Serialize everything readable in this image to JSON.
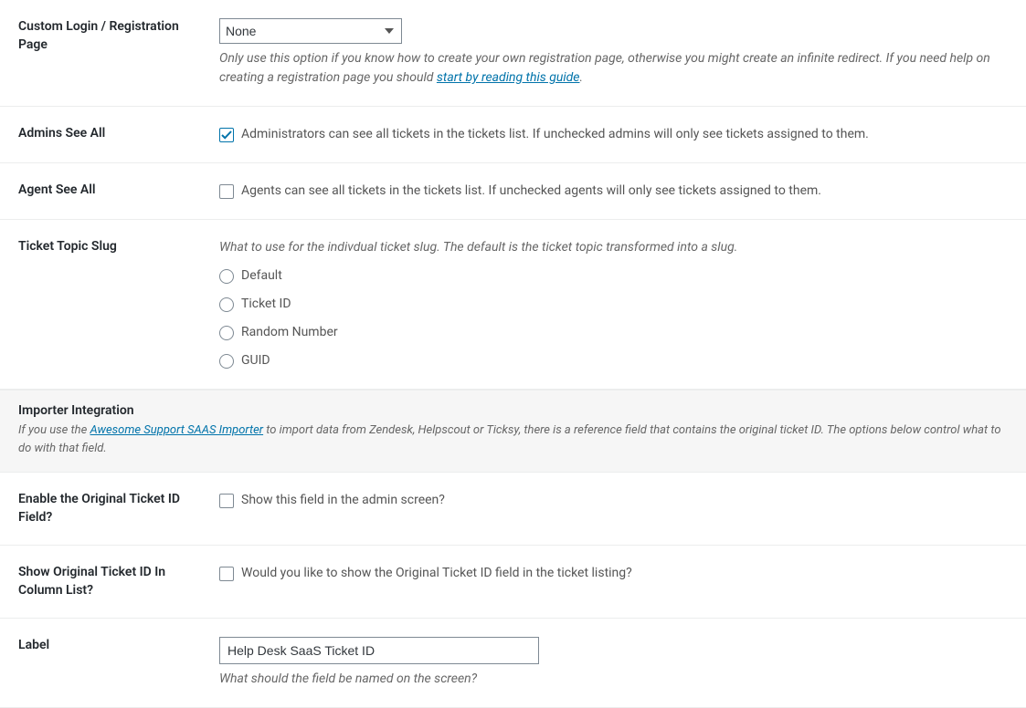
{
  "rows": {
    "custom_login": {
      "label": "Custom Login / Registration Page",
      "select_value": "None",
      "desc_pre": "Only use this option if you know how to create your own registration page, otherwise you might create an infinite redirect. If you need help on creating a registration page you should ",
      "desc_link": "start by reading this guide",
      "desc_post": "."
    },
    "admins_see_all": {
      "label": "Admins See All",
      "checked": true,
      "text": "Administrators can see all tickets in the tickets list. If unchecked admins will only see tickets assigned to them."
    },
    "agent_see_all": {
      "label": "Agent See All",
      "checked": false,
      "text": "Agents can see all tickets in the tickets list. If unchecked agents will only see tickets assigned to them."
    },
    "ticket_slug": {
      "label": "Ticket Topic Slug",
      "desc": "What to use for the indivdual ticket slug. The default is the ticket topic transformed into a slug.",
      "options": [
        "Default",
        "Ticket ID",
        "Random Number",
        "GUID"
      ]
    },
    "importer_section": {
      "title": "Importer Integration",
      "desc_pre": "If you use the ",
      "desc_link": "Awesome Support SAAS Importer",
      "desc_post": " to import data from Zendesk, Helpscout or Ticksy, there is a reference field that contains the original ticket ID. The options below control what to do with that field."
    },
    "enable_original_id": {
      "label": "Enable the Original Ticket ID Field?",
      "checked": false,
      "text": "Show this field in the admin screen?"
    },
    "show_original_in_col": {
      "label": "Show Original Ticket ID In Column List?",
      "checked": false,
      "text": "Would you like to show the Original Ticket ID field in the ticket listing?"
    },
    "label_field": {
      "label": "Label",
      "value": "Help Desk SaaS Ticket ID",
      "desc": "What should the field be named on the screen?"
    }
  }
}
